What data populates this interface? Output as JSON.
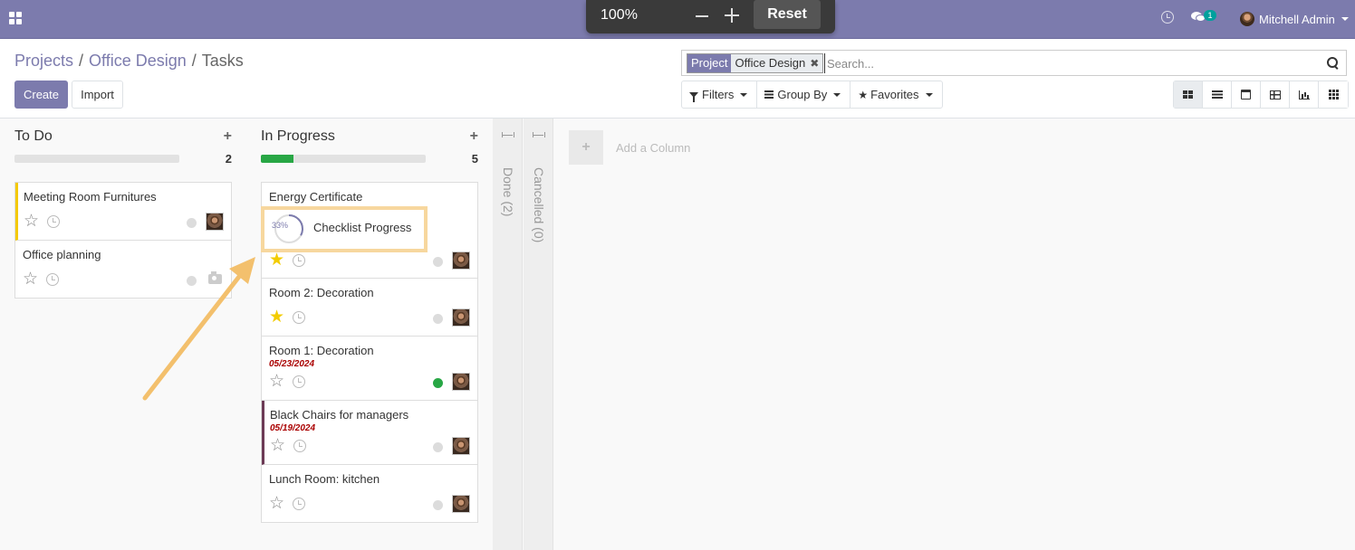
{
  "navbar": {
    "apps_icon": "apps-grid-icon",
    "activity_icon": "clock-icon",
    "messages_icon": "chat-icon",
    "messages_count": "1",
    "user_name": "Mitchell Admin"
  },
  "zoom": {
    "level": "100%",
    "reset_label": "Reset"
  },
  "breadcrumb": {
    "items": [
      "Projects",
      "Office Design",
      "Tasks"
    ]
  },
  "buttons": {
    "create": "Create",
    "import": "Import"
  },
  "search": {
    "facet_label": "Project",
    "facet_value": "Office Design",
    "facet_remove": "✖",
    "placeholder": "Search..."
  },
  "filters": {
    "filters_label": "Filters",
    "group_by_label": "Group By",
    "favorites_label": "Favorites"
  },
  "views": [
    "kanban",
    "list",
    "calendar",
    "pivot",
    "graph",
    "activity"
  ],
  "active_view": "kanban",
  "columns": [
    {
      "title": "To Do",
      "count": "2",
      "progress": 0,
      "cards": [
        {
          "title": "Meeting Room Furnitures",
          "date": "",
          "starred": false,
          "state": "normal",
          "assignee": "avatar"
        },
        {
          "title": "Office planning",
          "date": "",
          "starred": false,
          "state": "normal",
          "assignee": "none"
        }
      ]
    },
    {
      "title": "In Progress",
      "count": "5",
      "progress": 0.2,
      "cards": [
        {
          "title": "Energy Certificate",
          "date": "",
          "starred": true,
          "state": "normal",
          "assignee": "avatar",
          "checklist": {
            "percent": "33%",
            "label": "Checklist Progress",
            "value": 0.33
          }
        },
        {
          "title": "Room 2: Decoration",
          "date": "",
          "starred": true,
          "state": "normal",
          "assignee": "avatar"
        },
        {
          "title": "Room 1: Decoration",
          "date": "05/23/2024",
          "starred": false,
          "state": "done",
          "assignee": "avatar"
        },
        {
          "title": "Black Chairs for managers",
          "date": "05/19/2024",
          "starred": false,
          "state": "normal",
          "assignee": "avatar"
        },
        {
          "title": "Lunch Room: kitchen",
          "date": "",
          "starred": false,
          "state": "normal",
          "assignee": "avatar"
        }
      ]
    }
  ],
  "folded_columns": [
    {
      "label": "Done (2)"
    },
    {
      "label": "Cancelled (0)"
    }
  ],
  "add_column": {
    "plus": "+",
    "label": "Add a Column"
  },
  "colors": {
    "brand": "#7c7bad",
    "highlight": "#f7d79e",
    "deadline": "#aa0000",
    "done_state": "#28a745",
    "star_on": "#f3cc00"
  }
}
